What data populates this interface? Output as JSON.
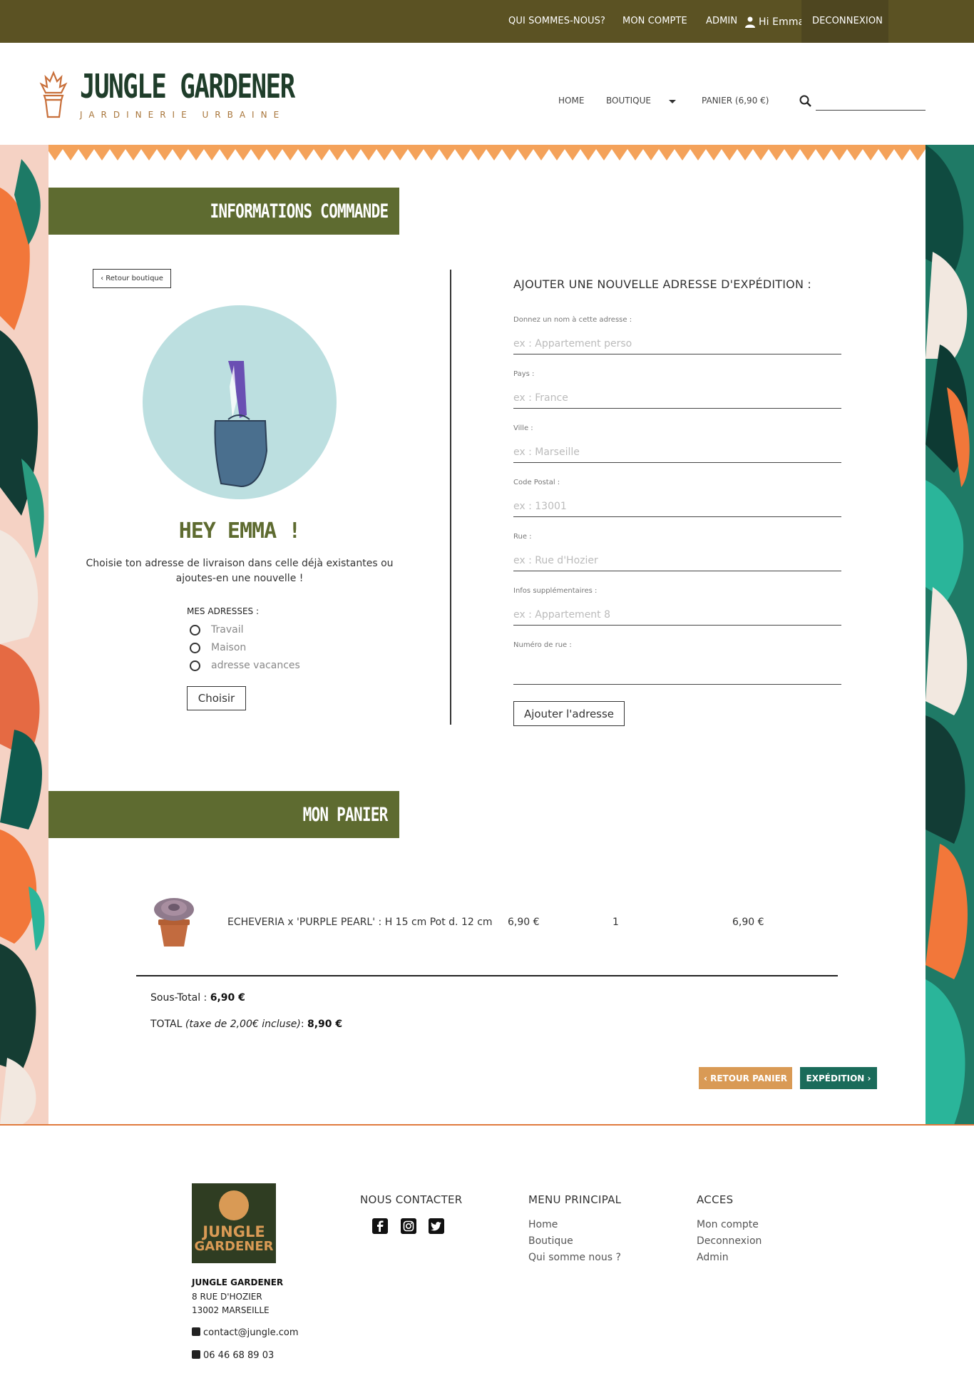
{
  "topbar": {
    "about": "QUI SOMMES-NOUS?",
    "account": "MON COMPTE",
    "admin": "ADMIN",
    "greeting": "Hi Emma",
    "logout": "DECONNEXION"
  },
  "header": {
    "brand": "JUNGLE GARDENER",
    "tagline": "JARDINERIE URBAINE",
    "nav_home": "HOME",
    "nav_shop": "BOUTIQUE",
    "nav_cart": "PANIER (6,90 €)",
    "search_value": ""
  },
  "order_info": {
    "section_title": "INFORMATIONS COMMANDE",
    "back_button": "‹ Retour boutique",
    "greeting": "HEY EMMA !",
    "intro": "Choisie ton adresse de livraison dans celle déjà existantes ou ajoutes-en une nouvelle !",
    "addresses_title": "MES ADRESSES :",
    "addresses": [
      "Travail",
      "Maison",
      "adresse vacances"
    ],
    "choose_button": "Choisir"
  },
  "new_address": {
    "title": "AJOUTER UNE NOUVELLE ADRESSE D'EXPÉDITION :",
    "fields": [
      {
        "label": "Donnez un nom à cette adresse :",
        "placeholder": "ex : Appartement perso"
      },
      {
        "label": "Pays :",
        "placeholder": "ex : France"
      },
      {
        "label": "Ville :",
        "placeholder": "ex : Marseille"
      },
      {
        "label": "Code Postal :",
        "placeholder": "ex : 13001"
      },
      {
        "label": "Rue :",
        "placeholder": "ex : Rue d'Hozier"
      },
      {
        "label": "Infos supplémentaires :",
        "placeholder": "ex : Appartement 8"
      },
      {
        "label": "Numéro de rue :",
        "placeholder": ""
      }
    ],
    "submit_button": "Ajouter l'adresse"
  },
  "cart": {
    "section_title": "MON PANIER",
    "items": [
      {
        "name": "ECHEVERIA x 'PURPLE PEARL' : H 15 cm Pot d. 12 cm",
        "unit_price": "6,90 €",
        "quantity": "1",
        "total": "6,90 €"
      }
    ],
    "subtotal_label": "Sous-Total : ",
    "subtotal_value": "6,90 €",
    "total_label": "TOTAL ",
    "total_note": "(taxe de 2,00€ incluse)",
    "total_colon": ": ",
    "total_value": "8,90 €",
    "back_button": "‹ RETOUR PANIER",
    "next_button": "EXPÉDITION ›"
  },
  "footer": {
    "logo_line1": "JUNGLE",
    "logo_line2": "GARDENER",
    "company": "JUNGLE GARDENER",
    "address_line1": "8 RUE D'HOZIER",
    "address_line2": "13002 MARSEILLE",
    "email": "contact@jungle.com",
    "phone": "06 46 68 89 03",
    "contact_title": "NOUS CONTACTER",
    "menu_title": "MENU PRINCIPAL",
    "menu_links": [
      "Home",
      "Boutique",
      "Qui somme nous ?"
    ],
    "access_title": "ACCES",
    "access_links": [
      "Mon compte",
      "Deconnexion",
      "Admin"
    ]
  },
  "colors": {
    "topbar": "#5b5223",
    "banner": "#5e6b30",
    "accent_orange": "#d99a55",
    "accent_teal": "#1a6b5a"
  }
}
